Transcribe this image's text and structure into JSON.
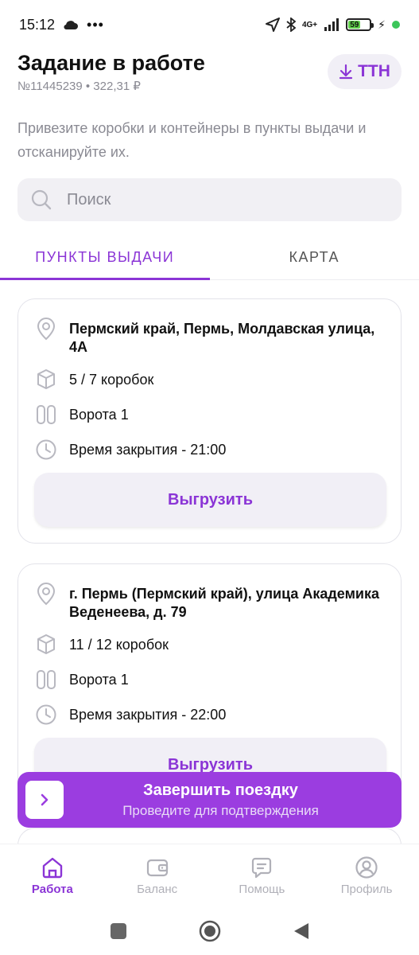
{
  "status": {
    "time": "15:12",
    "network": "4G+",
    "battery": "59"
  },
  "header": {
    "title": "Задание в работе",
    "subtitle": "№11445239 • 322,31 ₽",
    "ttn_label": "ТТН"
  },
  "description": "Привезите коробки и контейнеры в пункты выдачи и отсканируйте их.",
  "search": {
    "placeholder": "Поиск"
  },
  "tabs": [
    {
      "label": "ПУНКТЫ ВЫДАЧИ",
      "active": true
    },
    {
      "label": "КАРТА",
      "active": false
    }
  ],
  "cards": [
    {
      "address": "Пермский край, Пермь, Молдавская улица, 4А",
      "boxes": "5 / 7 коробок",
      "gate": "Ворота 1",
      "closing": "Время закрытия - 21:00",
      "button": "Выгрузить"
    },
    {
      "address": "г. Пермь (Пермский край), улица Академика Веденеева, д. 79",
      "boxes": "11 / 12 коробок",
      "gate": "Ворота 1",
      "closing": "Время закрытия - 22:00",
      "button": "Выгрузить"
    }
  ],
  "swipe": {
    "title": "Завершить поездку",
    "subtitle": "Проведите для подтверждения"
  },
  "bottom_nav": [
    {
      "label": "Работа",
      "icon": "home-icon",
      "active": true
    },
    {
      "label": "Баланс",
      "icon": "wallet-icon",
      "active": false
    },
    {
      "label": "Помощь",
      "icon": "chat-icon",
      "active": false
    },
    {
      "label": "Профиль",
      "icon": "profile-icon",
      "active": false
    }
  ],
  "colors": {
    "accent": "#8b35d6",
    "swipe_bg": "#9b3de0",
    "muted": "#8a8a93"
  }
}
